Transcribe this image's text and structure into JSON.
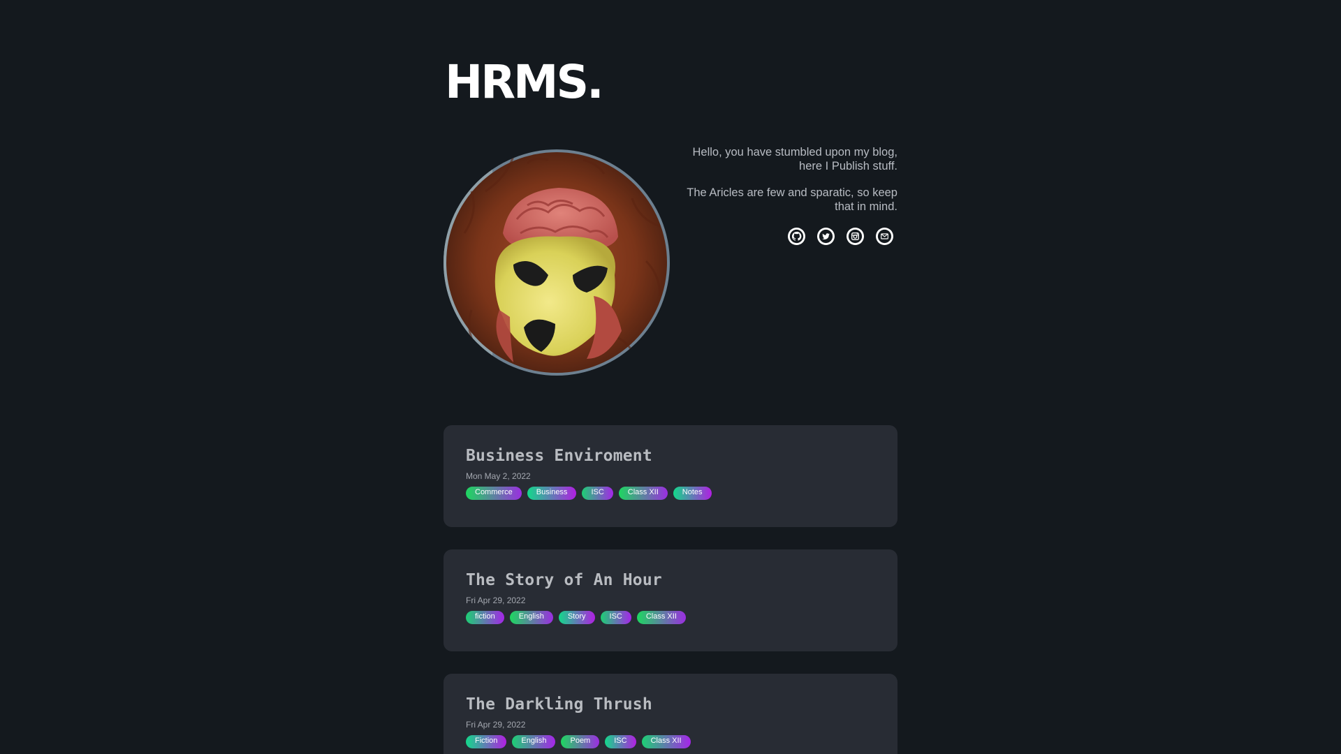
{
  "site": {
    "title": "HRMS."
  },
  "intro": {
    "line1": "Hello, you have stumbled upon my blog, here I Publish stuff.",
    "line2": "The Aricles are few and sparatic, so keep that in mind."
  },
  "socials": [
    {
      "icon": "github-icon"
    },
    {
      "icon": "twitter-icon"
    },
    {
      "icon": "instagram-icon"
    },
    {
      "icon": "mail-icon"
    }
  ],
  "posts": [
    {
      "title": "Business Enviroment",
      "date": "Mon May 2, 2022",
      "tags": [
        "Commerce",
        "Business",
        "ISC",
        "Class XII",
        "Notes"
      ]
    },
    {
      "title": "The Story of An Hour",
      "date": "Fri Apr 29, 2022",
      "tags": [
        "fiction",
        "English",
        "Story",
        "ISC",
        "Class XII"
      ]
    },
    {
      "title": "The Darkling Thrush",
      "date": "Fri Apr 29, 2022",
      "tags": [
        "Fiction",
        "English",
        "Poem",
        "ISC",
        "Class XII"
      ]
    }
  ],
  "colors": {
    "background": "#14191e",
    "card": "#282c34",
    "tag_gradient_start": "#1ed760",
    "tag_gradient_end": "#9b2ee0"
  }
}
